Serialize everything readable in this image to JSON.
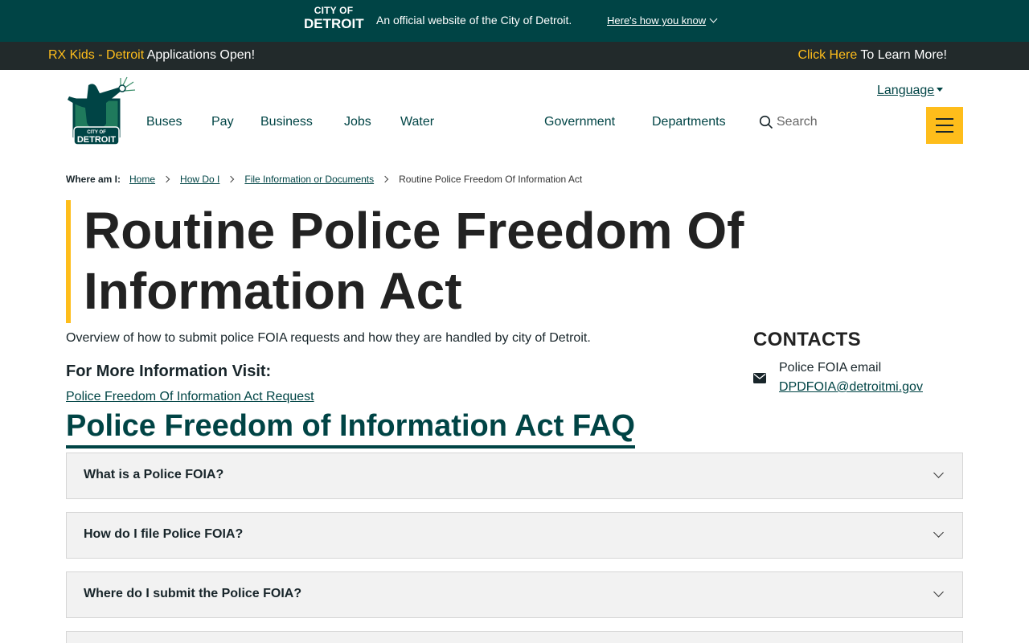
{
  "official_banner": {
    "logo_line1": "CITY OF",
    "logo_line2": "DETROIT",
    "text": "An official website of the City of Detroit.",
    "link": "Here's how you know"
  },
  "announcement": {
    "left_highlight": "RX Kids - Detroit",
    "left_text": " Applications Open!",
    "right_highlight": "Click Here",
    "right_text": " To Learn More!"
  },
  "header": {
    "logo_text_small": "CITY OF",
    "logo_text_big": "DETROIT",
    "language": "Language",
    "nav": {
      "buses": "Buses",
      "pay": "Pay",
      "business": "Business",
      "jobs": "Jobs",
      "water": "Water",
      "government": "Government",
      "departments": "Departments"
    },
    "search_placeholder": "Search"
  },
  "breadcrumb": {
    "label": "Where am I:",
    "items": [
      "Home",
      "How Do I",
      "File Information or Documents"
    ],
    "current": "Routine Police Freedom Of Information Act"
  },
  "page": {
    "title": "Routine Police Freedom Of Information Act",
    "overview": "Overview of how to submit police FOIA requests and how they are handled by city of Detroit.",
    "more_info_heading": "For More Information Visit:",
    "more_info_link": "Police Freedom Of Information Act Request"
  },
  "contacts": {
    "heading": "CONTACTS",
    "name": "Police FOIA email",
    "email": "DPDFOIA@detroitmi.gov"
  },
  "faq": {
    "title": "Police Freedom of Information Act FAQ",
    "items": [
      "What is a Police FOIA?",
      "How do I file Police FOIA?",
      "Where do I submit the Police FOIA?"
    ]
  },
  "colors": {
    "brand_green": "#004445",
    "accent_gold": "#febd1b",
    "dark_bar": "#222a2b",
    "faq_bg": "#f2f2f2"
  }
}
